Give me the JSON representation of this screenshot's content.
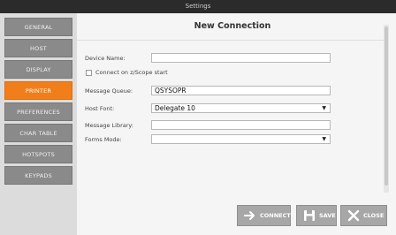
{
  "window": {
    "title": "Settings"
  },
  "sidebar": {
    "items": [
      {
        "label": "GENERAL",
        "active": false
      },
      {
        "label": "HOST",
        "active": false
      },
      {
        "label": "DISPLAY",
        "active": false
      },
      {
        "label": "PRINTER",
        "active": true
      },
      {
        "label": "PREFERENCES",
        "active": false
      },
      {
        "label": "CHAR TABLE",
        "active": false
      },
      {
        "label": "HOTSPOTS",
        "active": false
      },
      {
        "label": "KEYPADS",
        "active": false
      }
    ]
  },
  "panel": {
    "title": "New Connection"
  },
  "form": {
    "device_name": {
      "label": "Device Name:",
      "value": ""
    },
    "connect_on_start": {
      "label": "Connect on z/Scope start",
      "checked": false
    },
    "message_queue": {
      "label": "Message Queue:",
      "value": "QSYSOPR"
    },
    "host_font": {
      "label": "Host Font:",
      "value": "Delegate 10"
    },
    "message_library": {
      "label": "Message Library:",
      "value": ""
    },
    "forms_mode": {
      "label": "Forms Mode:",
      "value": ""
    }
  },
  "buttons": {
    "connect": {
      "label": "CONNECT",
      "icon": "arrow-right-icon"
    },
    "save": {
      "label": "SAVE",
      "icon": "floppy-disk-icon"
    },
    "close": {
      "label": "CLOSE",
      "icon": "close-icon"
    }
  },
  "colors": {
    "accent": "#f07e1b",
    "titlebar": "#2b2b2b",
    "nav": "#8a8a8a"
  }
}
